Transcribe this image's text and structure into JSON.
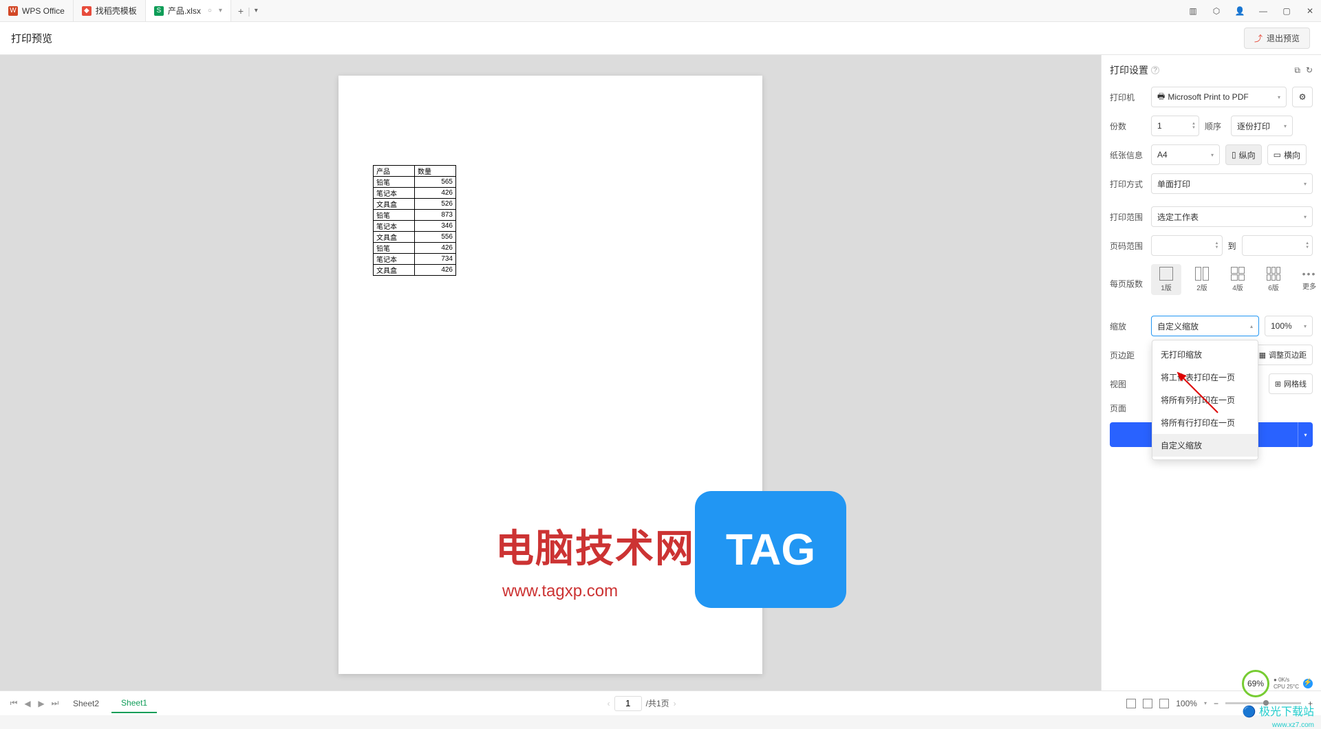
{
  "titlebar": {
    "tabs": [
      {
        "label": "WPS Office",
        "icon": "wps"
      },
      {
        "label": "找稻壳模板",
        "icon": "doc"
      },
      {
        "label": "产品.xlsx",
        "icon": "xls",
        "active": true
      }
    ]
  },
  "header": {
    "title": "打印预览",
    "exit_label": "退出预览"
  },
  "settings": {
    "title": "打印设置",
    "printer_label": "打印机",
    "printer_value": "Microsoft Print to PDF",
    "copies_label": "份数",
    "copies_value": "1",
    "order_label": "顺序",
    "order_value": "逐份打印",
    "paper_label": "纸张信息",
    "paper_value": "A4",
    "orientation_portrait": "纵向",
    "orientation_landscape": "横向",
    "duplex_label": "打印方式",
    "duplex_value": "单面打印",
    "range_label": "打印范围",
    "range_value": "选定工作表",
    "page_range_label": "页码范围",
    "page_range_to": "到",
    "layout_label": "每页版数",
    "layouts": [
      {
        "label": "1版",
        "kind": "single",
        "active": true
      },
      {
        "label": "2版",
        "kind": "split2"
      },
      {
        "label": "4版",
        "kind": "split4"
      },
      {
        "label": "6版",
        "kind": "split6"
      },
      {
        "label": "更多",
        "kind": "more"
      }
    ],
    "scale_label": "缩放",
    "scale_value": "自定义缩放",
    "scale_percent": "100%",
    "scale_options": [
      "无打印缩放",
      "将工作表打印在一页",
      "将所有列打印在一页",
      "将所有行打印在一页",
      "自定义缩放"
    ],
    "margin_label": "页边距",
    "margin_adjust": "调整页边距",
    "view_label": "视图",
    "gridlines": "网格线",
    "page_label": "页面"
  },
  "chart_data": {
    "type": "table",
    "headers": [
      "产品",
      "数量"
    ],
    "rows": [
      [
        "铅笔",
        565
      ],
      [
        "笔记本",
        426
      ],
      [
        "文具盒",
        526
      ],
      [
        "铅笔",
        873
      ],
      [
        "笔记本",
        346
      ],
      [
        "文具盒",
        556
      ],
      [
        "铅笔",
        426
      ],
      [
        "笔记本",
        734
      ],
      [
        "文具盒",
        426
      ]
    ]
  },
  "footer": {
    "sheets": [
      "Sheet2",
      "Sheet1"
    ],
    "active_sheet": "Sheet1",
    "page_current": "1",
    "page_total": "/共1页",
    "zoom": "100%"
  },
  "watermark": {
    "title": "电脑技术网",
    "url": "www.tagxp.com",
    "tag": "TAG",
    "site": "极光下载站",
    "site_url": "www.xz7.com",
    "cpu_percent": "69%",
    "cpu_speed": "0K/s",
    "cpu_temp": "CPU 25°C"
  }
}
